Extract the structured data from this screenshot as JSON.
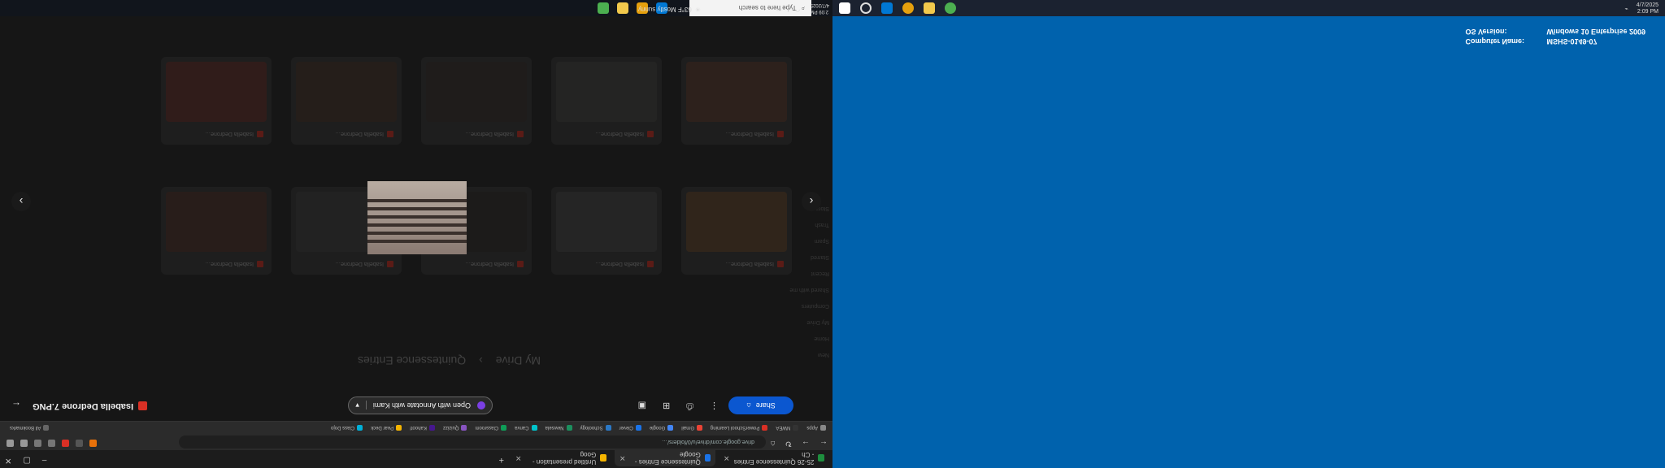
{
  "left_screen": {
    "tabs": [
      {
        "label": "25-26 Quintessence Entries - Ch",
        "color": "#1e8e3e",
        "active": false
      },
      {
        "label": "Quintessence Entries - Google",
        "color": "#1a73e8",
        "active": true
      },
      {
        "label": "Untitled presentation - Goog",
        "color": "#f4b400",
        "active": false
      }
    ],
    "address": "drive.google.com/drive/u/0/folders/…",
    "bookmarks": [
      "Apps",
      "NWEA",
      "PowerSchool Learning",
      "Gmail",
      "Google",
      "Clever",
      "Schoology",
      "Newsela",
      "Canva",
      "Classroom",
      "Quizizz",
      "Kahoot!",
      "Pear Deck",
      "Class Dojo",
      "All Bookmarks"
    ],
    "viewer": {
      "file_name": "Isabella Dedrone 7.PNG",
      "open_with_label": "Open with Annotate with Kami",
      "share_label": "Share",
      "back_icon": "arrow-left-icon"
    },
    "breadcrumb": [
      "My Drive",
      "Quintessence Entries"
    ],
    "sidebar_items": [
      "New",
      "Home",
      "My Drive",
      "Computers",
      "Shared with me",
      "Recent",
      "Starred",
      "Spam",
      "Trash",
      "Storage"
    ],
    "cards": [
      {
        "name": "Isabella Dedrone…",
        "thumb": "#4b3a2a"
      },
      {
        "name": "Isabella Dedrone…",
        "thumb": "#3a3a3a"
      },
      {
        "name": "Isabella Dedrone…",
        "thumb": "#2c2a28"
      },
      {
        "name": "Isabella Dedrone…",
        "thumb": "#353535"
      },
      {
        "name": "Isabella Dedrone…",
        "thumb": "#3e2d28"
      },
      {
        "name": "Isabella Dedrone…",
        "thumb": "#45342c"
      },
      {
        "name": "Isabella Dedrone…",
        "thumb": "#383836"
      },
      {
        "name": "Isabella Dedrone…",
        "thumb": "#302c2a"
      },
      {
        "name": "Isabella Dedrone…",
        "thumb": "#3a2f28"
      },
      {
        "name": "Isabella Dedrone…",
        "thumb": "#4a2c28"
      }
    ],
    "taskbar": {
      "search_placeholder": "Type here to search",
      "weather": "63°F  Mostly sunny",
      "time": "2:09 PM",
      "date": "4/7/2025"
    }
  },
  "right_screen": {
    "taskbar": {
      "time": "2:09 PM",
      "date": "4/7/2025"
    },
    "sysinfo": {
      "os_label": "OS Version:",
      "os_value": "Windows 10 Enterprise 2009",
      "computer_label": "Computer Name:",
      "computer_value": "MSHS-0149-07"
    }
  },
  "colors": {
    "desktop_blue": "#0062ad",
    "share_blue": "#0b57d0",
    "kami_purple": "#7b3fe4"
  }
}
